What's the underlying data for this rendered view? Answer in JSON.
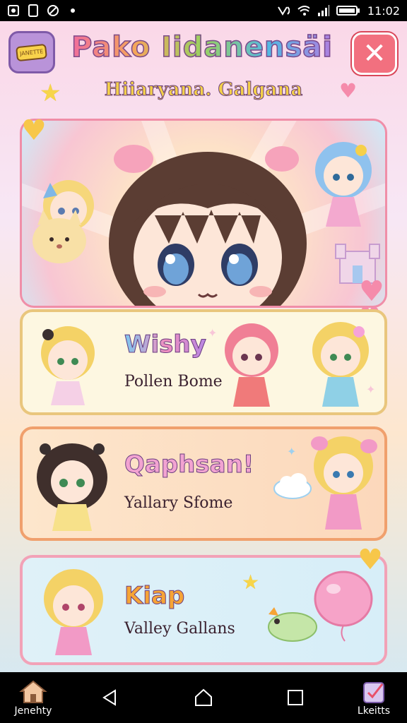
{
  "status_bar": {
    "time": "11:02"
  },
  "header": {
    "logo_tag": "JANETTE",
    "title": "Pako Iidanensäi",
    "subtitle": "Hiiaryana. Galgana",
    "close_label": "✕"
  },
  "cards": [
    {
      "name": "Wishy",
      "desc": "Pollen Bome"
    },
    {
      "name": "Qaphsan!",
      "desc": "Yallary Sfome"
    },
    {
      "name": "Kiap",
      "desc": "Valley Gallans"
    }
  ],
  "nav": {
    "home_label": "Jenehty",
    "profile_label": "Lkeitts"
  },
  "colors": {
    "accent_pink": "#f08ea8",
    "close_red": "#f2707f",
    "title_stroke": "#7b4b8c"
  }
}
